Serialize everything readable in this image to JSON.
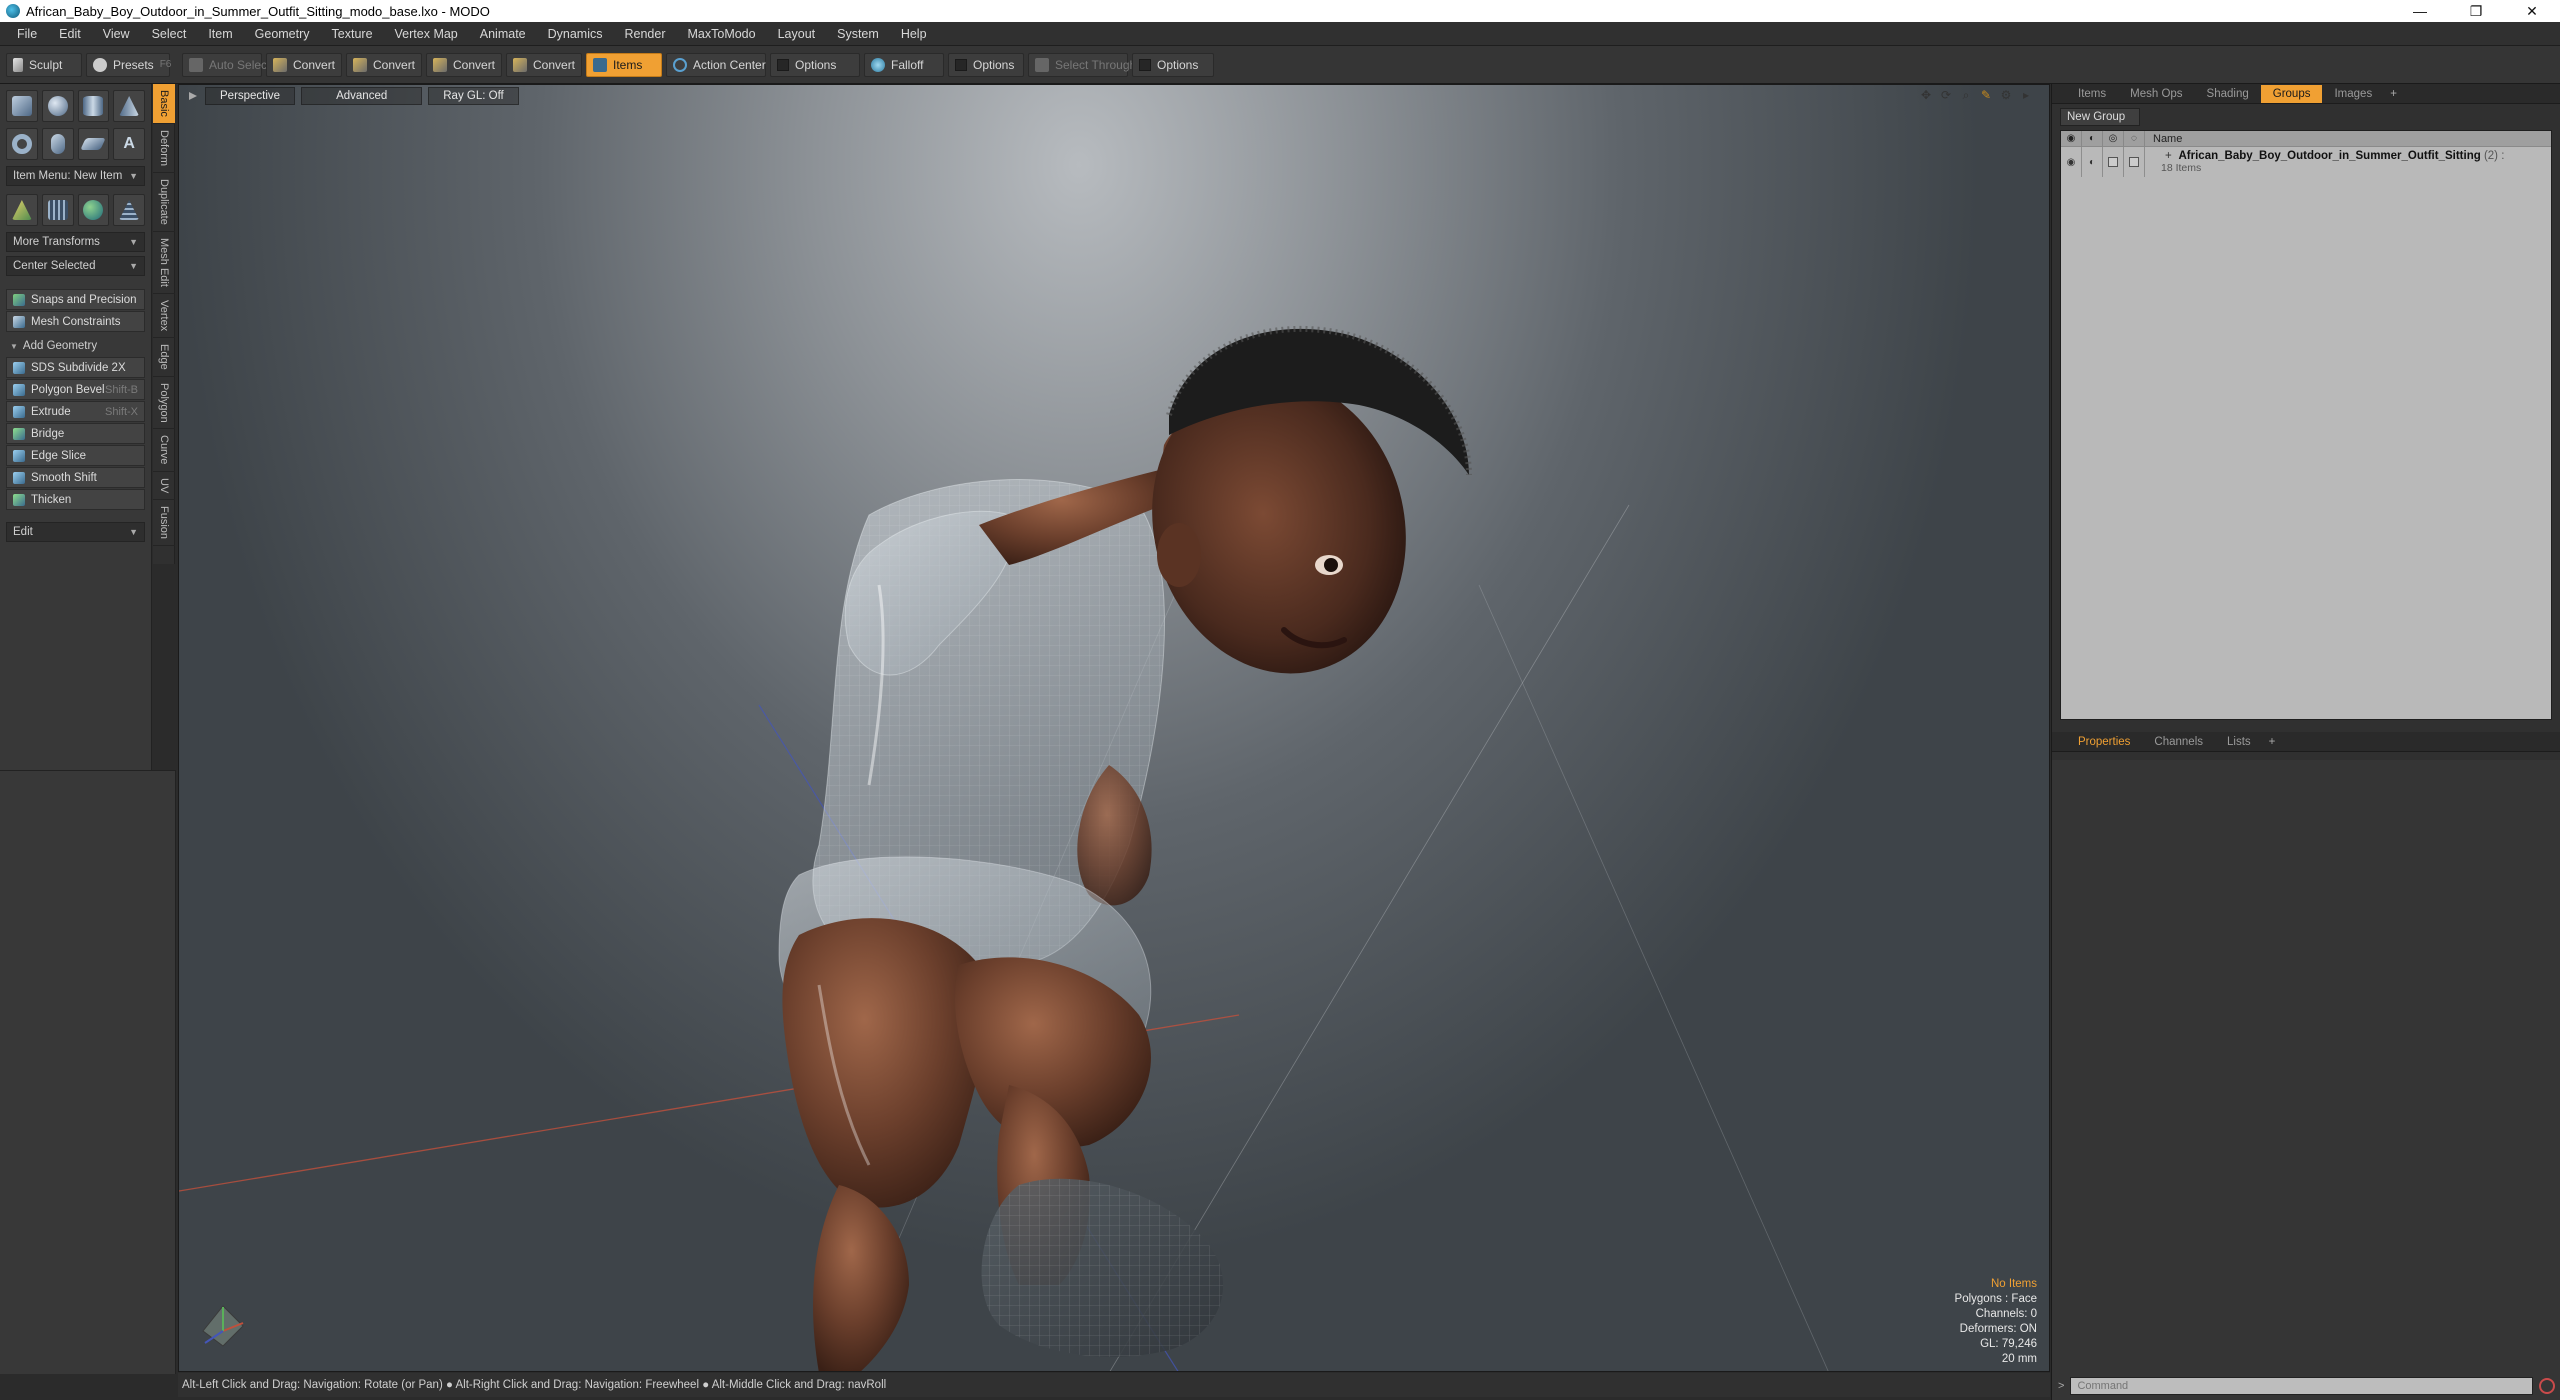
{
  "window": {
    "title": "African_Baby_Boy_Outdoor_in_Summer_Outfit_Sitting_modo_base.lxo - MODO",
    "minimize": "—",
    "maximize": "❐",
    "close": "✕"
  },
  "menu": [
    "File",
    "Edit",
    "View",
    "Select",
    "Item",
    "Geometry",
    "Texture",
    "Vertex Map",
    "Animate",
    "Dynamics",
    "Render",
    "MaxToModo",
    "Layout",
    "System",
    "Help"
  ],
  "toolbar": {
    "sculpt": "Sculpt",
    "presets": "Presets",
    "presets_key": "F6",
    "auto_select": "Auto Select",
    "convert1": "Convert",
    "convert2": "Convert",
    "convert3": "Convert",
    "convert4": "Convert",
    "items": "Items",
    "action_center": "Action Center",
    "options1": "Options",
    "falloff": "Falloff",
    "options2": "Options",
    "select_through": "Select Through",
    "options3": "Options"
  },
  "left_panel": {
    "item_menu": "Item Menu: New Item",
    "more_transforms": "More Transforms",
    "center_selected": "Center Selected",
    "snaps": "Snaps and Precision",
    "mesh_constraints": "Mesh Constraints",
    "add_geometry": "Add Geometry",
    "tools": [
      {
        "label": "SDS Subdivide 2X",
        "shortcut": ""
      },
      {
        "label": "Polygon Bevel",
        "shortcut": "Shift-B"
      },
      {
        "label": "Extrude",
        "shortcut": "Shift-X"
      },
      {
        "label": "Bridge",
        "shortcut": ""
      },
      {
        "label": "Edge Slice",
        "shortcut": ""
      },
      {
        "label": "Smooth Shift",
        "shortcut": ""
      },
      {
        "label": "Thicken",
        "shortcut": ""
      }
    ],
    "edit": "Edit"
  },
  "vertical_tabs": [
    "Basic",
    "Deform",
    "Duplicate",
    "Mesh Edit",
    "Vertex",
    "Edge",
    "Polygon",
    "Curve",
    "UV",
    "Fusion"
  ],
  "viewport": {
    "tabs": [
      "Perspective",
      "Advanced",
      "Ray GL: Off"
    ],
    "hud": {
      "no_items": "No Items",
      "polygons": "Polygons : Face",
      "channels": "Channels: 0",
      "deformers": "Deformers: ON",
      "gl": "GL: 79,246",
      "units": "20 mm"
    }
  },
  "statusbar": "Alt-Left Click and Drag: Navigation: Rotate (or Pan) ● Alt-Right Click and Drag: Navigation: Freewheel ● Alt-Middle Click and Drag: navRoll",
  "right_panel": {
    "tabs": [
      "Items",
      "Mesh Ops",
      "Shading",
      "Groups",
      "Images",
      "+"
    ],
    "new_group": "New Group",
    "name_header": "Name",
    "group_name": "African_Baby_Boy_Outdoor_in_Summer_Outfit_Sitting",
    "group_count": "(2) :",
    "group_sub": "18 Items",
    "prop_tabs": [
      "Properties",
      "Channels",
      "Lists",
      "+"
    ],
    "command_placeholder": "Command"
  },
  "colors": {
    "accent": "#f0a033",
    "skin": "#6b3f2c"
  }
}
